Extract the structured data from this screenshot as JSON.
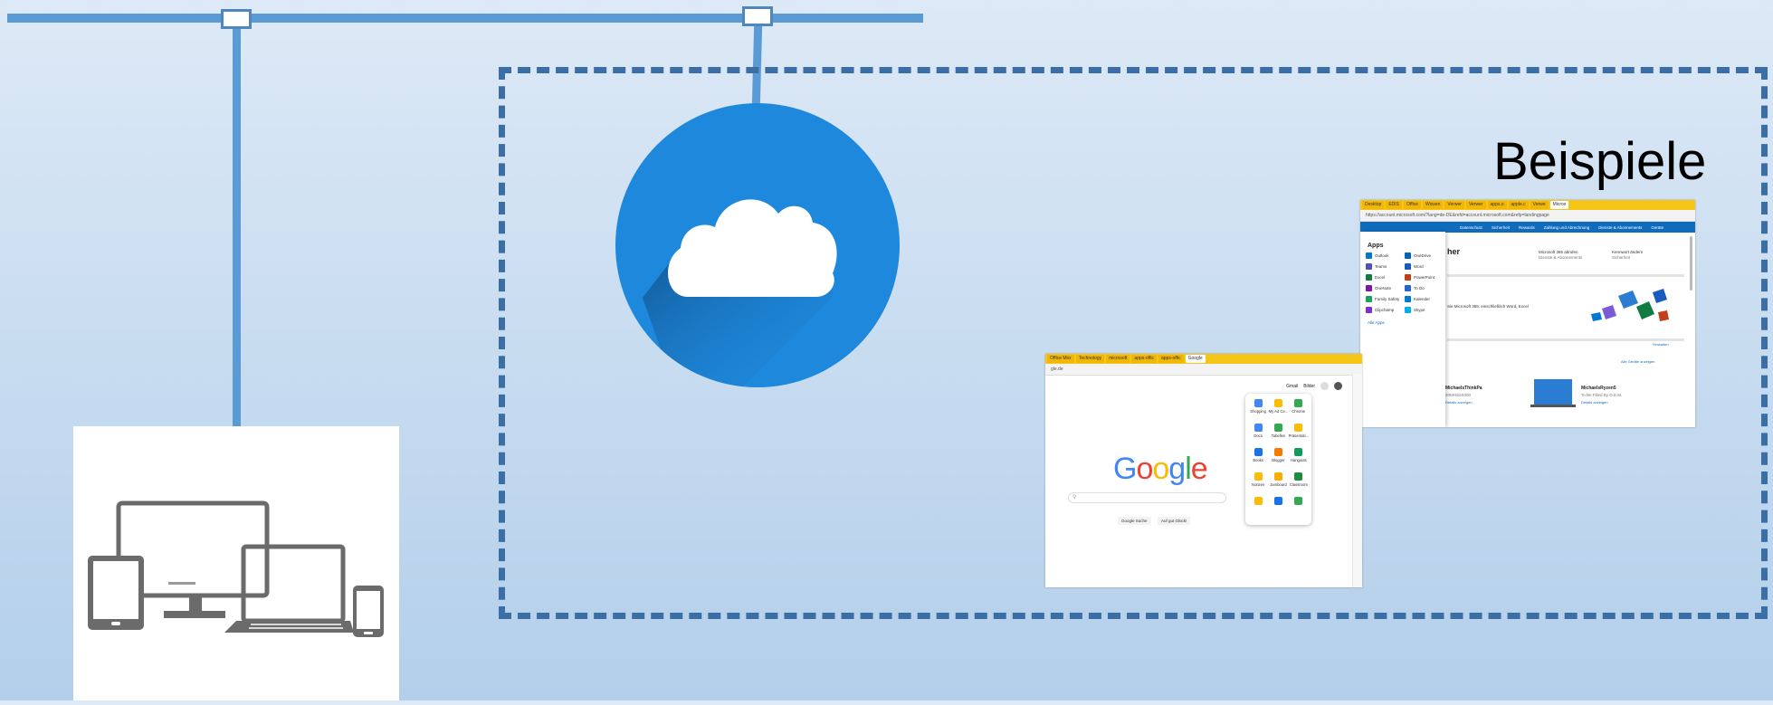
{
  "title": "Beispiele",
  "icons": {
    "cloud": "cloud-icon",
    "devices": "devices-icon"
  },
  "colors": {
    "bus": "#5b9bd5",
    "boundary": "#3a6ea5",
    "cloud_circle": "#1e88dc"
  },
  "microsoft_screenshot": {
    "tabs": [
      "Desktop",
      "EDIS",
      "Office",
      "Wissen",
      "Verwer",
      "Verwer",
      "apps.o",
      "apple.c",
      "Verwe",
      "Micros"
    ],
    "address": "https://account.microsoft.com/?lang=de-DE&refd=account.microsoft.com&refp=landingpage",
    "nav": [
      "Datenschutz",
      "Sicherheit",
      "Rewards",
      "Zahlung und Abrechnung",
      "Dienste & Abonnements",
      "Geräte"
    ],
    "panel_title": "Microsoft 365",
    "apps_title": "Apps",
    "apps": [
      "Outlook",
      "OneDrive",
      "Teams",
      "Word",
      "Excel",
      "PowerPoint",
      "OneNote",
      "To Do",
      "Family Safety",
      "Kalender",
      "Clipchamp",
      "Skype"
    ],
    "more_apps": "Alle Apps",
    "heading": "her",
    "info1": "Microsoft 365 abrufen",
    "info1_sub": "Dienste & Abonnements",
    "info2": "Kennwort ändern",
    "info2_sub": "Sicherheit",
    "promo_text": "Sie Microsoft 365, einschließlich Word, Excel",
    "more_link": "Verwalten",
    "devices_link": "Alle Geräte anzeigen",
    "device1_name": "MichaelsThinkPa",
    "device1_sub": "20MHS0X000",
    "device1_link": "Details anzeigen",
    "device2_name": "MichaelsRyzen5",
    "device2_sub": "To Be Filled By O.E.M.",
    "device2_link": "Details anzeigen"
  },
  "google_screenshot": {
    "tabs": [
      "Office Micr",
      "Technology",
      "microsoft",
      "apps-offic",
      "apps-offic",
      "Google"
    ],
    "address": "gle.de",
    "gmail": "Gmail",
    "images": "Bilder",
    "logo_letters": [
      "G",
      "o",
      "o",
      "g",
      "l",
      "e"
    ],
    "logo_colors": [
      "#4285f4",
      "#ea4335",
      "#fbbc05",
      "#4285f4",
      "#34a853",
      "#ea4335"
    ],
    "search_button": "Google Suche",
    "lucky_button": "Auf gut Glück!",
    "apps": [
      {
        "label": "Shopping",
        "color": "#4285f4"
      },
      {
        "label": "My Ad Ce...",
        "color": "#fbbc05"
      },
      {
        "label": "Chrome",
        "color": "#34a853"
      },
      {
        "label": "Docs",
        "color": "#4285f4"
      },
      {
        "label": "Tabellen",
        "color": "#34a853"
      },
      {
        "label": "Präsentati...",
        "color": "#fbbc05"
      },
      {
        "label": "Books",
        "color": "#1a73e8"
      },
      {
        "label": "Blogger",
        "color": "#f57c00"
      },
      {
        "label": "Hangouts",
        "color": "#0f9d58"
      },
      {
        "label": "Notizen",
        "color": "#fbbc05"
      },
      {
        "label": "Jamboard",
        "color": "#f9ab00"
      },
      {
        "label": "Classroom",
        "color": "#1e8e3e"
      },
      {
        "label": "",
        "color": "#fbbc05"
      },
      {
        "label": "",
        "color": "#1a73e8"
      },
      {
        "label": "",
        "color": "#34a853"
      }
    ]
  }
}
